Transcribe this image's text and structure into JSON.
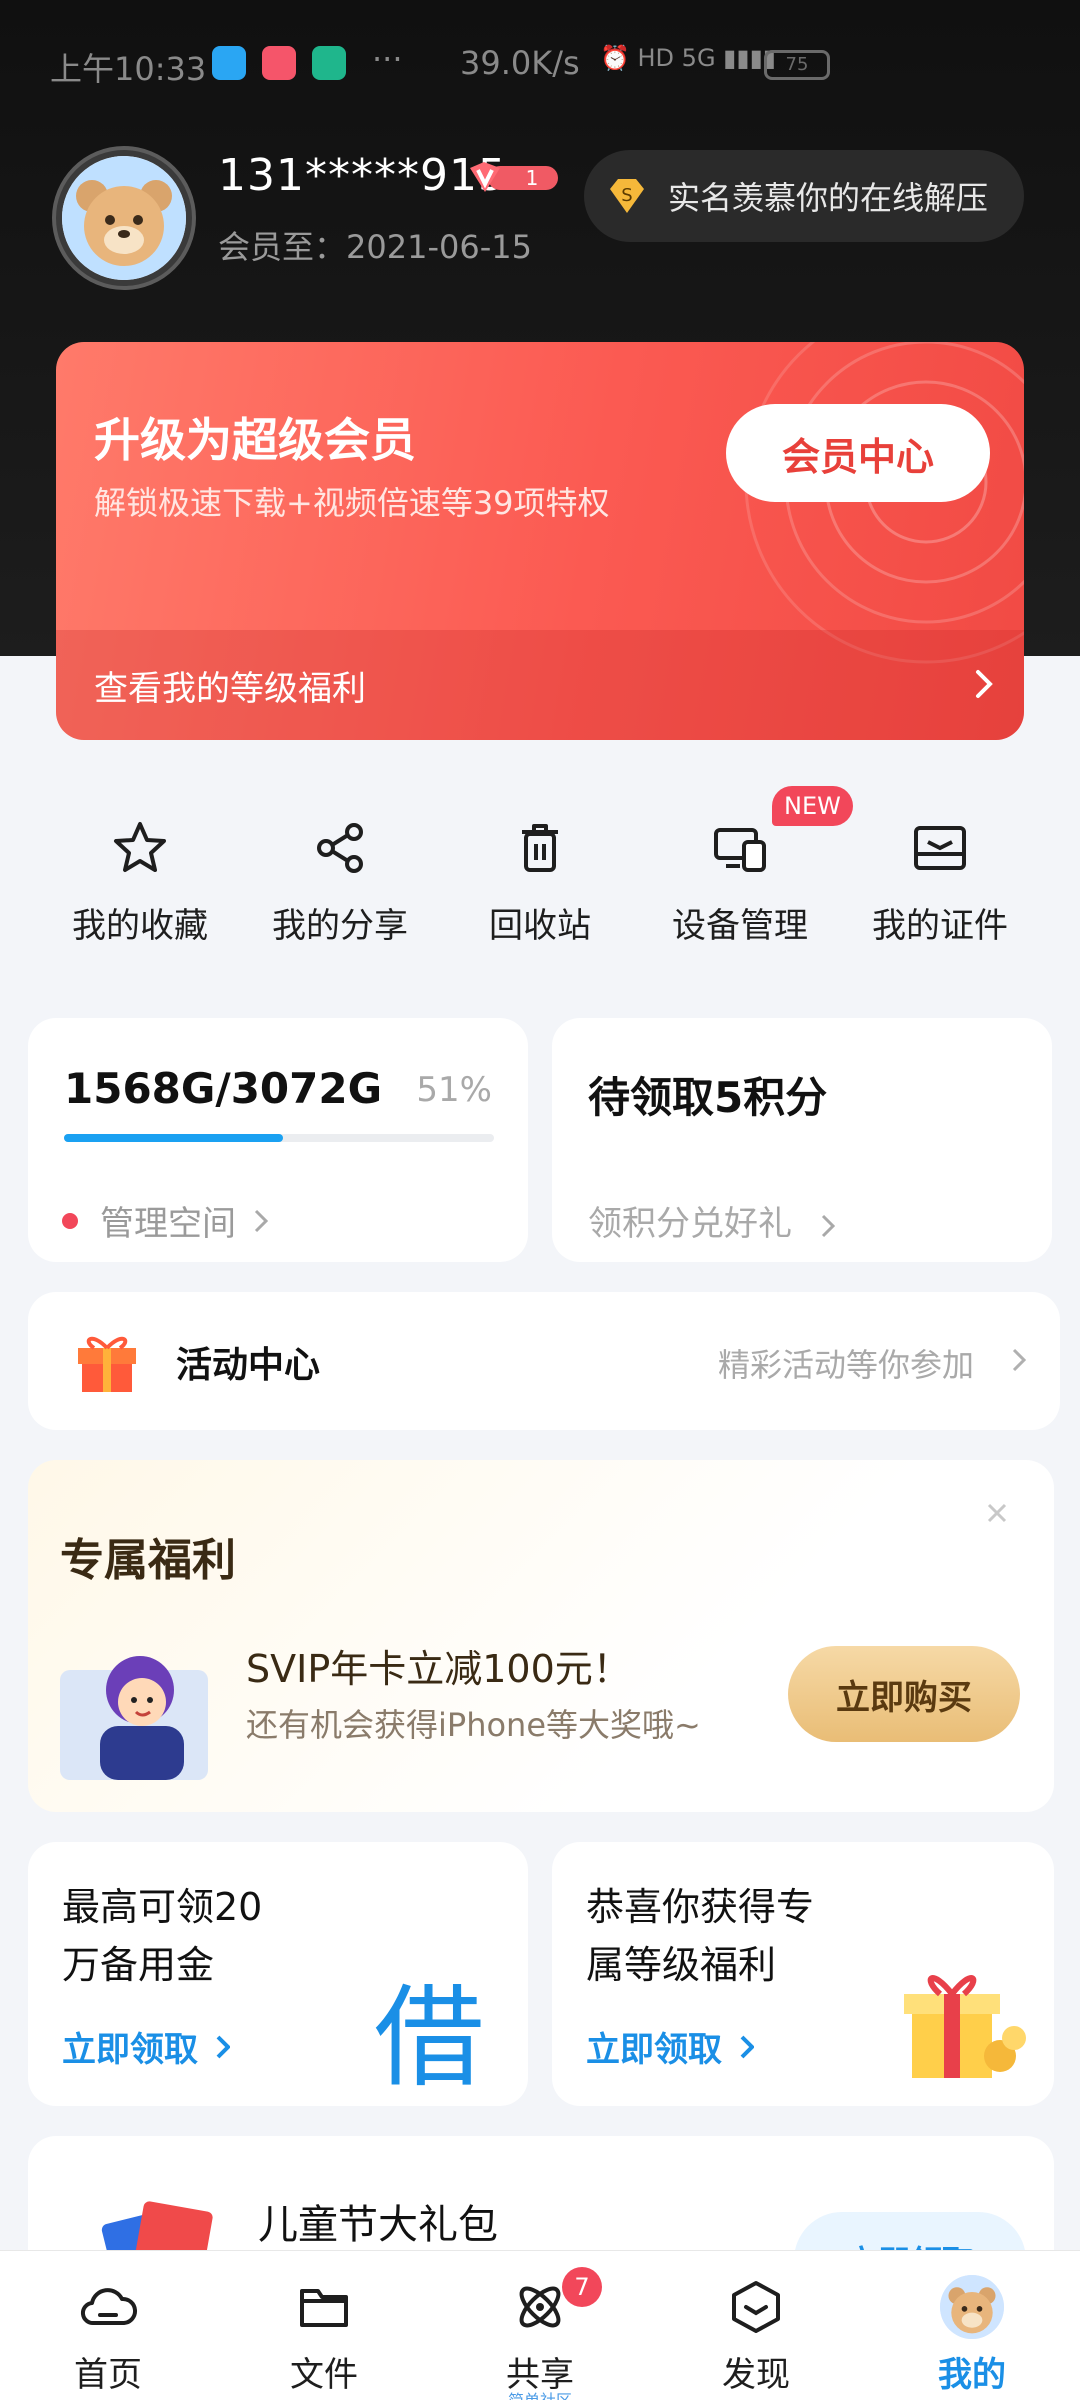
{
  "status_bar": {
    "time": "上午10:33",
    "dots": "···",
    "net_speed": "39.0K/s",
    "system": "⏰ HD 5G ▮▮▮▮",
    "battery": "75"
  },
  "profile": {
    "username": "131*****915",
    "vip_level": "1",
    "member_until": "会员至：2021-06-15",
    "realname_text": "实名羡慕你的在线解压"
  },
  "vip_card": {
    "title": "升级为超级会员",
    "subtitle": "解锁极速下载+视频倍速等39项特权",
    "center_button": "会员中心",
    "level_benefits": "查看我的等级福利"
  },
  "quick_actions": [
    {
      "label": "我的收藏",
      "icon": "star-icon"
    },
    {
      "label": "我的分享",
      "icon": "share-icon"
    },
    {
      "label": "回收站",
      "icon": "trash-icon"
    },
    {
      "label": "设备管理",
      "icon": "devices-icon",
      "badge": "NEW"
    },
    {
      "label": "我的证件",
      "icon": "id-card-icon"
    }
  ],
  "storage": {
    "capacity": "1568G/3072G",
    "percent": "51%",
    "used_fraction": 0.51,
    "manage_label": "管理空间"
  },
  "points": {
    "title": "待领取5积分",
    "subtitle": "领积分兑好礼"
  },
  "activity": {
    "title": "活动中心",
    "hint": "精彩活动等你参加"
  },
  "exclusive": {
    "title": "专属福利",
    "promo": "SVIP年卡立减100元！",
    "sub": "还有机会获得iPhone等大奖哦~",
    "buy_button": "立即购买"
  },
  "loan_card": {
    "line1": "最高可领20",
    "line2": "万备用金",
    "link": "立即领取",
    "big_char": "借"
  },
  "gift_card": {
    "line1": "恭喜你获得专",
    "line2": "属等级福利",
    "link": "立即领取"
  },
  "kids_card": {
    "title": "儿童节大礼包",
    "button": "立即领取"
  },
  "bottom_nav": [
    {
      "label": "首页",
      "icon": "cloud-icon"
    },
    {
      "label": "文件",
      "icon": "folder-icon"
    },
    {
      "label": "共享",
      "icon": "orbit-icon",
      "badge": "7",
      "sub": "简单社区"
    },
    {
      "label": "发现",
      "icon": "cube-icon"
    },
    {
      "label": "我的",
      "icon": "avatar-icon",
      "active": true
    }
  ],
  "colors": {
    "accent": "#1a8fe6",
    "vip_red": "#fb5a52",
    "badge_red": "#f2475a"
  }
}
